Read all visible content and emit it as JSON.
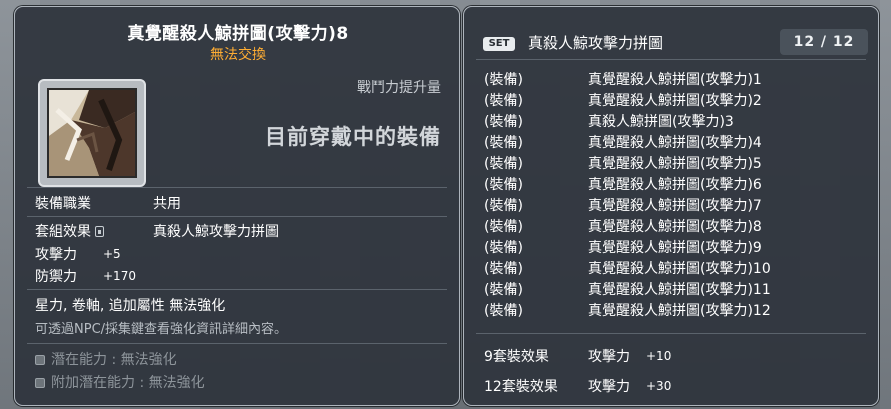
{
  "left_panel": {
    "title": "真覺醒殺人鯨拼圖(攻擊力)8",
    "untradeable": "無法交換",
    "cp_label": "戰鬥力提升量",
    "equipped_label": "目前穿戴中的裝備",
    "job_label": "裝備職業",
    "job_value": "共用",
    "set_label": "套組效果",
    "set_value": "真殺人鯨攻擊力拼圖",
    "attack_label": "攻擊力",
    "attack_value": "+5",
    "defense_label": "防禦力",
    "defense_value": "+170",
    "enhance_text": "星力, 卷軸, 追加屬性 無法強化",
    "npc_hint": "可透過NPC/採集鍵查看強化資訊詳細內容。",
    "potential_label": "潛在能力 : 無法強化",
    "bonus_potential_label": "附加潛在能力 : 無法強化"
  },
  "right_panel": {
    "set_badge": "SET",
    "set_name": "真殺人鯨攻擊力拼圖",
    "count": "12 / 12",
    "items": [
      {
        "type": "(裝備)",
        "name": "真覺醒殺人鯨拼圖(攻擊力)1"
      },
      {
        "type": "(裝備)",
        "name": "真覺醒殺人鯨拼圖(攻擊力)2"
      },
      {
        "type": "(裝備)",
        "name": "真殺人鯨拼圖(攻擊力)3"
      },
      {
        "type": "(裝備)",
        "name": "真覺醒殺人鯨拼圖(攻擊力)4"
      },
      {
        "type": "(裝備)",
        "name": "真覺醒殺人鯨拼圖(攻擊力)5"
      },
      {
        "type": "(裝備)",
        "name": "真覺醒殺人鯨拼圖(攻擊力)6"
      },
      {
        "type": "(裝備)",
        "name": "真覺醒殺人鯨拼圖(攻擊力)7"
      },
      {
        "type": "(裝備)",
        "name": "真覺醒殺人鯨拼圖(攻擊力)8"
      },
      {
        "type": "(裝備)",
        "name": "真覺醒殺人鯨拼圖(攻擊力)9"
      },
      {
        "type": "(裝備)",
        "name": "真覺醒殺人鯨拼圖(攻擊力)10"
      },
      {
        "type": "(裝備)",
        "name": "真覺醒殺人鯨拼圖(攻擊力)11"
      },
      {
        "type": "(裝備)",
        "name": "真覺醒殺人鯨拼圖(攻擊力)12"
      }
    ],
    "effects": [
      {
        "label": "9套裝效果",
        "stat": "攻擊力",
        "value": "+10"
      },
      {
        "label": "12套裝效果",
        "stat": "攻擊力",
        "value": "+30"
      }
    ]
  },
  "colors": {
    "untradeable": "#ffad33",
    "panel_bg": "#2e343c"
  }
}
